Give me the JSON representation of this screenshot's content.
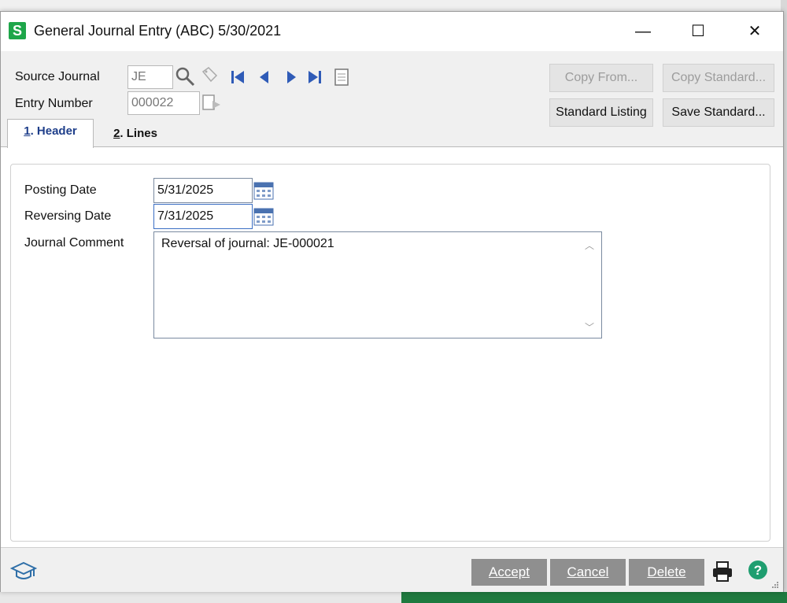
{
  "window": {
    "title": "General Journal Entry (ABC) 5/30/2021",
    "app_icon_letter": "S",
    "minimize": "—",
    "maximize": "☐",
    "close": "✕"
  },
  "header": {
    "source_journal_label": "Source Journal",
    "source_journal_value": "JE",
    "entry_number_label": "Entry Number",
    "entry_number_value": "000022"
  },
  "buttons": {
    "copy_from": "Copy From...",
    "copy_standard": "Copy Standard...",
    "standard_listing": "Standard Listing",
    "save_standard": "Save Standard..."
  },
  "tabs": [
    {
      "num": "1",
      "label": ". Header"
    },
    {
      "num": "2",
      "label": ". Lines"
    }
  ],
  "form": {
    "posting_date_label": "Posting Date",
    "posting_date_value": "5/31/2025",
    "reversing_date_label": "Reversing Date",
    "reversing_date_value": "7/31/2025",
    "journal_comment_label": "Journal Comment",
    "journal_comment_value": "Reversal of journal: JE-000021"
  },
  "footer": {
    "accept": "Accept",
    "cancel": "Cancel",
    "delete": "Delete"
  },
  "colors": {
    "brand_green": "#1ea64a",
    "nav_blue": "#2f5bb7",
    "active_tab_text": "#1e3e8a",
    "footer_button": "#8f8f8f"
  }
}
